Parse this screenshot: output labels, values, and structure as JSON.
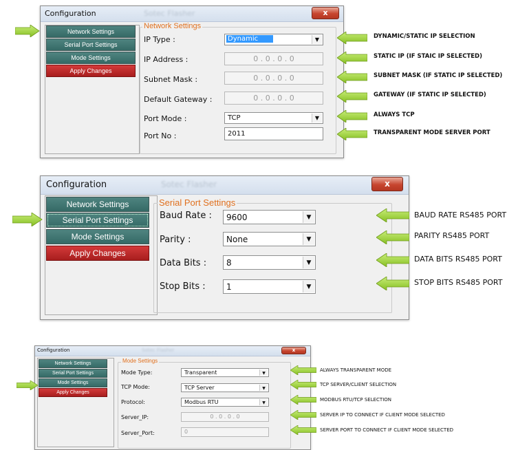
{
  "colors": {
    "nav_green": "#3f7773",
    "nav_red": "#c02a2a",
    "accent_orange": "#e0701e",
    "arrow_green": "#9fd23a"
  },
  "win1": {
    "title": "Configuration",
    "title_blur": "Sotec Flasher",
    "close_label": "x",
    "nav": [
      "Network Settings",
      "Serial Port Settings",
      "Mode Settings",
      "Apply Changes"
    ],
    "group_title": "Network Settings",
    "fields": [
      {
        "label": "IP Type :",
        "value": "Dynamic"
      },
      {
        "label": "IP Address :",
        "value": "0 . 0 . 0 . 0"
      },
      {
        "label": "Subnet Mask :",
        "value": "0 . 0 . 0 . 0"
      },
      {
        "label": "Default Gateway :",
        "value": "0 . 0 . 0 . 0"
      },
      {
        "label": "Port Mode :",
        "value": "TCP"
      },
      {
        "label": "Port No :",
        "value": "2011"
      }
    ],
    "annotations": [
      "DYNAMIC/STATIC IP SELECTION",
      "STATIC IP (IF STAIC IP SELECTED)",
      "SUBNET MASK (IF STATIC IP SELECTED)",
      "GATEWAY (IF STATIC IP SELECTED)",
      "ALWAYS TCP",
      "TRANSPARENT MODE SERVER PORT"
    ]
  },
  "win2": {
    "title": "Configuration",
    "title_blur": "Sotec Flasher",
    "close_label": "x",
    "nav": [
      "Network Settings",
      "Serial Port Settings",
      "Mode Settings",
      "Apply Changes"
    ],
    "group_title": "Serial Port Settings",
    "fields": [
      {
        "label": "Baud Rate :",
        "value": "9600"
      },
      {
        "label": "Parity :",
        "value": "None"
      },
      {
        "label": "Data Bits :",
        "value": "8"
      },
      {
        "label": "Stop Bits :",
        "value": "1"
      }
    ],
    "annotations": [
      "BAUD RATE RS485 PORT",
      "PARITY RS485 PORT",
      "DATA BITS RS485 PORT",
      "STOP BITS RS485 PORT"
    ]
  },
  "win3": {
    "title": "Configuration",
    "title_blur": "Sotec Flasher",
    "close_label": "x",
    "nav": [
      "Network Settings",
      "Serial Port Settings",
      "Mode Settings",
      "Apply Changes"
    ],
    "group_title": "Mode Settings",
    "fields": [
      {
        "label": "Mode Type:",
        "value": "Transparent"
      },
      {
        "label": "TCP Mode:",
        "value": "TCP Server"
      },
      {
        "label": "Protocol:",
        "value": "Modbus RTU"
      },
      {
        "label": "Server_IP:",
        "value": "0 . 0 . 0 . 0"
      },
      {
        "label": "Server_Port:",
        "value": "0"
      }
    ],
    "annotations": [
      "ALWAYS TRANSPARENT MODE",
      "TCP SERVER/CLIENT SELECTION",
      "MODBUS RTU/TCP SELECTION",
      "SERVER IP TO CONNECT IF CLIENT MODE SELECTED",
      "SERVER PORT TO CONNECT IF CLIENT MODE SELECTED"
    ]
  }
}
